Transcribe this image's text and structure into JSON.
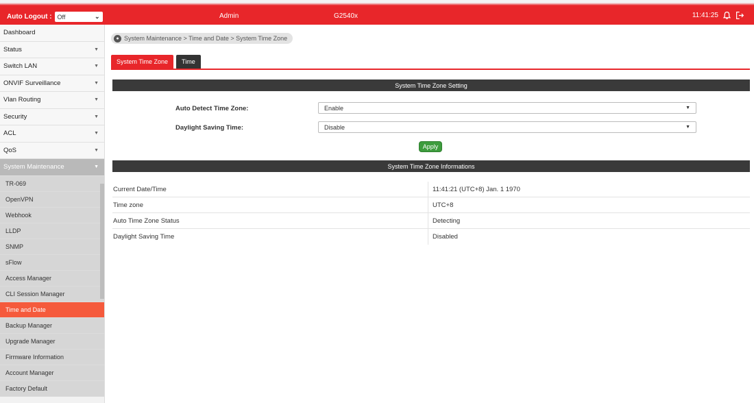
{
  "topbar": {
    "auto_logout_label": "Auto Logout :",
    "auto_logout_value": "Off",
    "user": "Admin",
    "model": "G2540x",
    "time": "11:41:25",
    "bg_color": "#e8262a"
  },
  "sidebar": {
    "items": [
      {
        "label": "Dashboard",
        "caret": false
      },
      {
        "label": "Status",
        "caret": true
      },
      {
        "label": "Switch LAN",
        "caret": true
      },
      {
        "label": "ONVIF Surveillance",
        "caret": true
      },
      {
        "label": "Vlan Routing",
        "caret": true
      },
      {
        "label": "Security",
        "caret": true
      },
      {
        "label": "ACL",
        "caret": true
      },
      {
        "label": "QoS",
        "caret": true
      },
      {
        "label": "System Maintenance",
        "caret": true
      }
    ],
    "sub_items": [
      "TR-069",
      "OpenVPN",
      "Webhook",
      "LLDP",
      "SNMP",
      "sFlow",
      "Access Manager",
      "CLI Session Manager",
      "Time and Date",
      "Backup Manager",
      "Upgrade Manager",
      "Firmware Information",
      "Account Manager",
      "Factory Default"
    ],
    "active_sub": "Time and Date"
  },
  "breadcrumb": "System Maintenance > Time and Date  > System Time Zone",
  "tabs": [
    {
      "label": "System Time Zone",
      "active": true
    },
    {
      "label": "Time",
      "active": false
    }
  ],
  "settings": {
    "header": "System Time Zone Setting",
    "auto_detect_label": "Auto Detect Time Zone:",
    "auto_detect_value": "Enable",
    "dst_label": "Daylight Saving Time:",
    "dst_value": "Disable",
    "apply_label": "Apply"
  },
  "info": {
    "header": "System Time Zone Informations",
    "rows": [
      {
        "key": "Current Date/Time",
        "value": "11:41:21 (UTC+8) Jan. 1 1970"
      },
      {
        "key": "Time zone",
        "value": "UTC+8"
      },
      {
        "key": "Auto Time Zone Status",
        "value": "Detecting"
      },
      {
        "key": "Daylight Saving Time",
        "value": "Disabled"
      }
    ]
  },
  "icons": {
    "bell": "bell-icon",
    "logout": "logout-icon",
    "pin": "location-pin-icon"
  }
}
